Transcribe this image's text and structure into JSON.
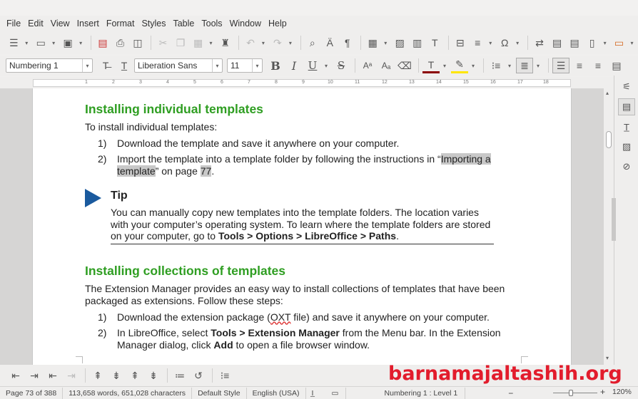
{
  "menu": [
    "File",
    "Edit",
    "View",
    "Insert",
    "Format",
    "Styles",
    "Table",
    "Tools",
    "Window",
    "Help"
  ],
  "formatting": {
    "paragraph_style": "Numbering 1",
    "font_name": "Liberation Sans",
    "font_size": "11"
  },
  "ruler_ticks": [
    "1",
    "2",
    "3",
    "4",
    "5",
    "6",
    "7",
    "8",
    "9",
    "10",
    "11",
    "12",
    "13",
    "14",
    "15",
    "16",
    "17",
    "18"
  ],
  "document": {
    "section1": {
      "heading": "Installing individual templates",
      "intro": "To install individual templates:",
      "items": [
        {
          "num": "1)",
          "text": "Download the template and save it anywhere on your computer."
        },
        {
          "num": "2)",
          "pre": "Import the template into a template folder by following the instructions in “",
          "link1": "Importing a template",
          "mid": "” on page ",
          "link2": "77",
          "post": "."
        }
      ]
    },
    "tip": {
      "heading": "Tip",
      "text_pre": "You can manually copy new templates into the template folders. The location varies with your computer’s operating system. To learn where the template folders are stored on your computer, go to ",
      "text_bold": "Tools > Options > LibreOffice > Paths",
      "text_post": "."
    },
    "section2": {
      "heading": "Installing collections of templates",
      "intro": "The Extension Manager provides an easy way to install collections of templates that have been packaged as extensions. Follow these steps:",
      "item1_num": "1)",
      "item1_pre": "Download the extension package (",
      "item1_squig": "OXT",
      "item1_post": " file) and save it anywhere on your computer.",
      "item2_num": "2)",
      "item2_pre": "In LibreOffice, select ",
      "item2_bold1": "Tools > Extension Manager",
      "item2_mid": " from the Menu bar. In the Extension Manager dialog, click ",
      "item2_bold2": "Add",
      "item2_post": " to open a file browser window."
    }
  },
  "status": {
    "page": "Page 73 of 388",
    "words": "113,658 words, 651,028 characters",
    "page_style": "Default Style",
    "language": "English (USA)",
    "list_level": "Numbering 1 : Level 1",
    "zoom_minus": "−",
    "zoom_plus": "+",
    "zoom": "120%"
  },
  "watermark": "barnamajaltashih.org",
  "colors": {
    "heading_green": "#2f9e22",
    "tip_arrow_blue": "#1a5a9e",
    "watermark_red": "#e21c2c",
    "highlight_gray": "#c8c8c8"
  }
}
